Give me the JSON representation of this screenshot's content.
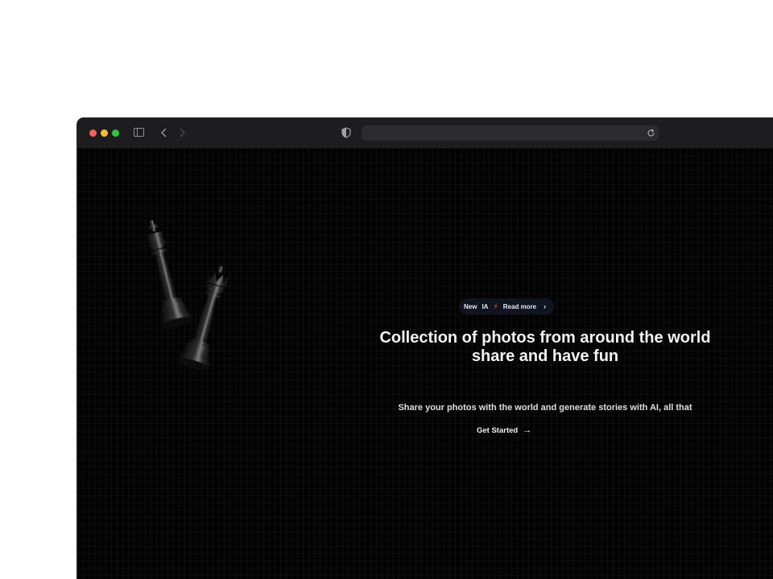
{
  "browser": {
    "icons": [
      "sidebar-icon",
      "back-icon",
      "forward-icon",
      "shield-icon",
      "reload-icon"
    ],
    "traffic_lights": [
      "#ff5f57",
      "#febc2e",
      "#28c840"
    ]
  },
  "announcement": {
    "tag": "New",
    "topic": "IA",
    "link": "Read more",
    "icon": "lightning-icon",
    "icon_color": "#ff7a1a"
  },
  "hero": {
    "title_line1": "Collection of photos from around the world",
    "title_line2": "share and have fun",
    "subtitle": "Share your photos with the world and generate stories with AI, all that",
    "cta_label": "Get Started"
  },
  "colors": {
    "background": "#030303",
    "text": "#f2f2f2",
    "chip_background": "#0f1420"
  }
}
